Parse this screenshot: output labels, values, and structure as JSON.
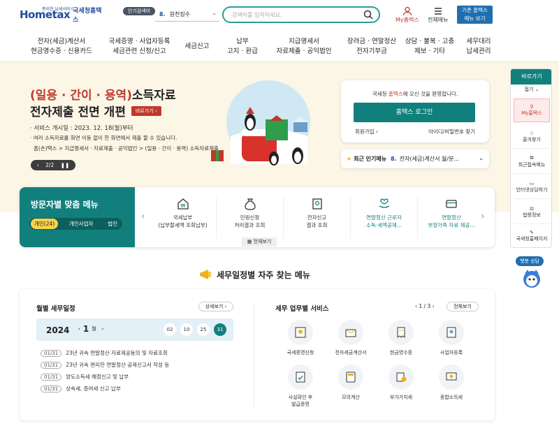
{
  "header": {
    "logo_text": "Hometax",
    "logo_tagline": "편리한 납세서비스",
    "logo_name": "국세청홈택스",
    "popular_badge": "인기검색어",
    "popular_num": "8.",
    "popular_value": "원천징수",
    "search_placeholder": "검색어를 입력하세요.",
    "myhome": "My홈택스",
    "allmenu": "전체메뉴",
    "classic_line1": "기존 홈택스",
    "classic_line2": "메뉴 보기"
  },
  "nav": [
    "전자(세금)계산서\n현금영수증 · 신용카드",
    "국세증명 · 사업자등록\n세금관련 신청/신고",
    "세금신고",
    "납부\n고지 · 환급",
    "지급명세서\n자료제출 · 공익법인",
    "장려금 · 연말정산\n전자기부금",
    "상담 · 불복 · 고충\n제보 · 기타",
    "세무대리\n납세관리"
  ],
  "banner": {
    "title_red": "(일용 · 간이 · 용역)",
    "title_rest": "소득자료",
    "title2": "전자제출 전면 개편",
    "shortcut": "바로가기",
    "date": "· 서비스 개시일 : 2023. 12. 18(월)부터",
    "desc": "· 여러 소득자료를 화면 이동 없이 한 화면에서 제출 할 수 있습니다.",
    "path": "홈(손)택스 > 지급명세서 · 자료제출 · 공익법인 > (일용 · 간이 · 용역) 소득자료제출",
    "pager": "2/2"
  },
  "login": {
    "welcome_pre": "국세청 ",
    "welcome_hl": "홈택스",
    "welcome_post": "에 오신 것을 환영합니다.",
    "button": "홈택스 로그인",
    "join": "회원가입",
    "find": "아이디/비밀번호 찾기"
  },
  "recent": {
    "label": "최근 인기메뉴",
    "num": "8.",
    "value": "전자(세금)계산서 월/분..."
  },
  "visitor": {
    "title": "방문자별 맞춤 메뉴",
    "tabs": [
      "개인(24)",
      "개인사업자",
      "법인"
    ],
    "items": [
      {
        "line1": "국세납부",
        "line2": "(납부할세액 조회납부)"
      },
      {
        "line1": "민원신청",
        "line2": "처리결과 조회"
      },
      {
        "line1": "전자신고",
        "line2": "결과 조회"
      },
      {
        "line1": "연말정산 근로자",
        "line2": "소득·세액공제..."
      },
      {
        "line1": "연말정산",
        "line2": "부양가족 자료 제공..."
      }
    ],
    "allview": "전체보기"
  },
  "rside": {
    "head": "바로가기",
    "fold": "접기",
    "items": [
      "My홈택스",
      "즐겨찾기",
      "최근접속메뉴",
      "인터넷상담하기",
      "법령정보",
      "국세청홈페이지"
    ]
  },
  "chatbot": "챗봇 상담",
  "section_title": "세무일정별 자주 찾는 메뉴",
  "schedule": {
    "title": "월별 세무일정",
    "detail": "상세보기",
    "year": "2024",
    "month": "1",
    "month_unit": "월",
    "days": [
      "02",
      "10",
      "25",
      "31"
    ],
    "events": [
      {
        "date": "01/31",
        "text": "23년 귀속 연말정산 자료제공동의 및 자료조회"
      },
      {
        "date": "01/31",
        "text": "23년 귀속 편리한 연말정산 공제신고서 작성 등"
      },
      {
        "date": "01/31",
        "text": "양도소득세 예정신고 및 납부"
      },
      {
        "date": "01/31",
        "text": "상속세, 증여세 신고 납부"
      }
    ]
  },
  "services": {
    "title": "세무 업무별 서비스",
    "page": "1 / 3",
    "allview": "전체보기",
    "items": [
      {
        "l1": "국세증명신청",
        "l2": ""
      },
      {
        "l1": "전자세금계산서",
        "l2": ""
      },
      {
        "l1": "현금영수증",
        "l2": ""
      },
      {
        "l1": "사업자등록",
        "l2": ""
      },
      {
        "l1": "사실확인 후",
        "l2": "발급증명"
      },
      {
        "l1": "모의계산",
        "l2": ""
      },
      {
        "l1": "부가가치세",
        "l2": ""
      },
      {
        "l1": "종합소득세",
        "l2": ""
      }
    ]
  },
  "colors": {
    "teal": "#11807d",
    "red": "#c0392b",
    "navy": "#1f4e9c"
  }
}
